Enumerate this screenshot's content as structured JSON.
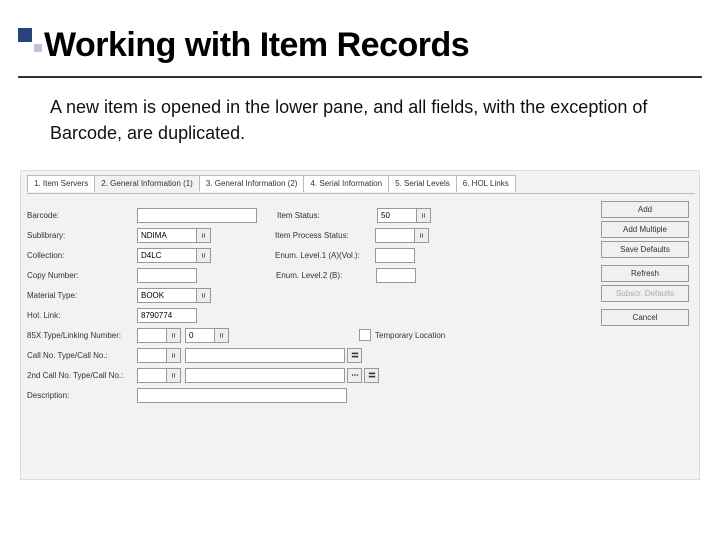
{
  "slide": {
    "title": "Working with Item Records",
    "description": "A new item is opened in the lower pane, and all fields, with the exception of Barcode, are duplicated."
  },
  "panel": {
    "tabs": [
      "1. Item Servers",
      "2. General Information (1)",
      "3. General Information (2)",
      "4. Serial Information",
      "5. Serial Levels",
      "6. HOL Links"
    ]
  },
  "form": {
    "barcode": {
      "label": "Barcode:",
      "value": ""
    },
    "item_status": {
      "label": "Item Status:",
      "value": "50"
    },
    "sublibrary": {
      "label": "Sublibrary:",
      "value": "NDIMA"
    },
    "item_process_status": {
      "label": "Item Process Status:",
      "value": ""
    },
    "collection": {
      "label": "Collection:",
      "value": "D4LC"
    },
    "enum_level_1": {
      "label": "Enum. Level.1 (A)(Vol.):",
      "value": ""
    },
    "copy_number": {
      "label": "Copy Number:",
      "value": ""
    },
    "enum_level_2": {
      "label": "Enum. Level.2 (B):",
      "value": ""
    },
    "material_type": {
      "label": "Material Type:",
      "value": "BOOK"
    },
    "hol_link": {
      "label": "Hol. Link:",
      "value": "8790774"
    },
    "linking_number": {
      "label": "85X Type/Linking Number:",
      "type_value": "",
      "num_value": "0"
    },
    "temporary_location": {
      "label": "Temporary Location",
      "checked": false
    },
    "call_no": {
      "label": "Call No. Type/Call No.:",
      "value": ""
    },
    "second_call_no": {
      "label": "2nd Call No. Type/Call No.:",
      "value": ""
    },
    "description": {
      "label": "Description:",
      "value": ""
    }
  },
  "buttons": {
    "add": "Add",
    "add_multiple": "Add Multiple",
    "save_defaults": "Save Defaults",
    "refresh": "Refresh",
    "subscr_defaults": "Subscr. Defaults",
    "cancel": "Cancel"
  }
}
